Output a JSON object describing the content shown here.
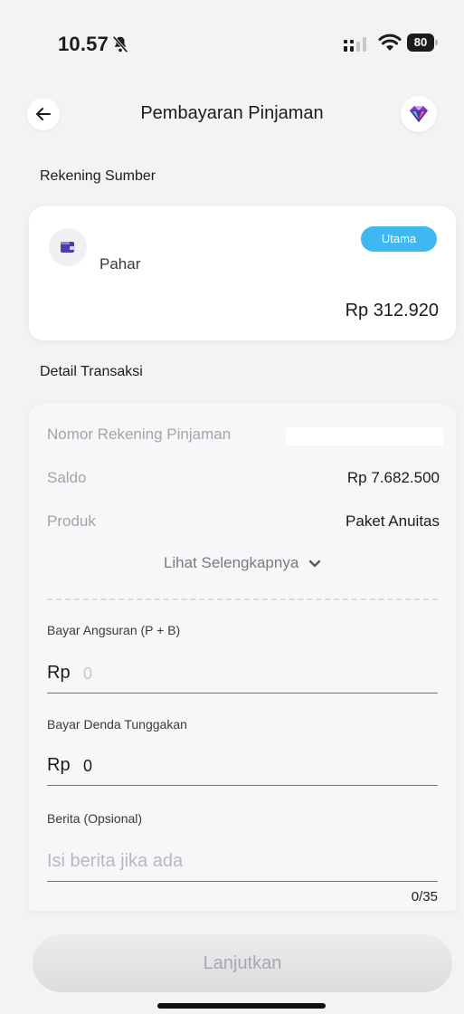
{
  "status_bar": {
    "time": "10.57",
    "battery": "80"
  },
  "header": {
    "title": "Pembayaran Pinjaman"
  },
  "source_section": {
    "label": "Rekening Sumber",
    "account": {
      "holder": "Pahar",
      "badge": "Utama",
      "balance": "Rp 312.920"
    }
  },
  "detail_section": {
    "label": "Detail Transaksi",
    "rows": [
      {
        "key": "Nomor Rekening Pinjaman",
        "value": ""
      },
      {
        "key": "Saldo",
        "value": "Rp 7.682.500"
      },
      {
        "key": "Produk",
        "value": "Paket Anuitas"
      }
    ],
    "see_more": "Lihat Selengkapnya"
  },
  "form": {
    "installment": {
      "label": "Bayar Angsuran (P + B)",
      "prefix": "Rp",
      "value": "0"
    },
    "penalty": {
      "label": "Bayar Denda Tunggakan",
      "prefix": "Rp",
      "value": "0"
    },
    "note": {
      "label": "Berita (Opsional)",
      "placeholder": "Isi berita jika ada",
      "counter": "0/35"
    }
  },
  "footer": {
    "continue_label": "Lanjutkan"
  },
  "colors": {
    "accent": "#5b6cd6",
    "badge": "#3fb8f2"
  }
}
